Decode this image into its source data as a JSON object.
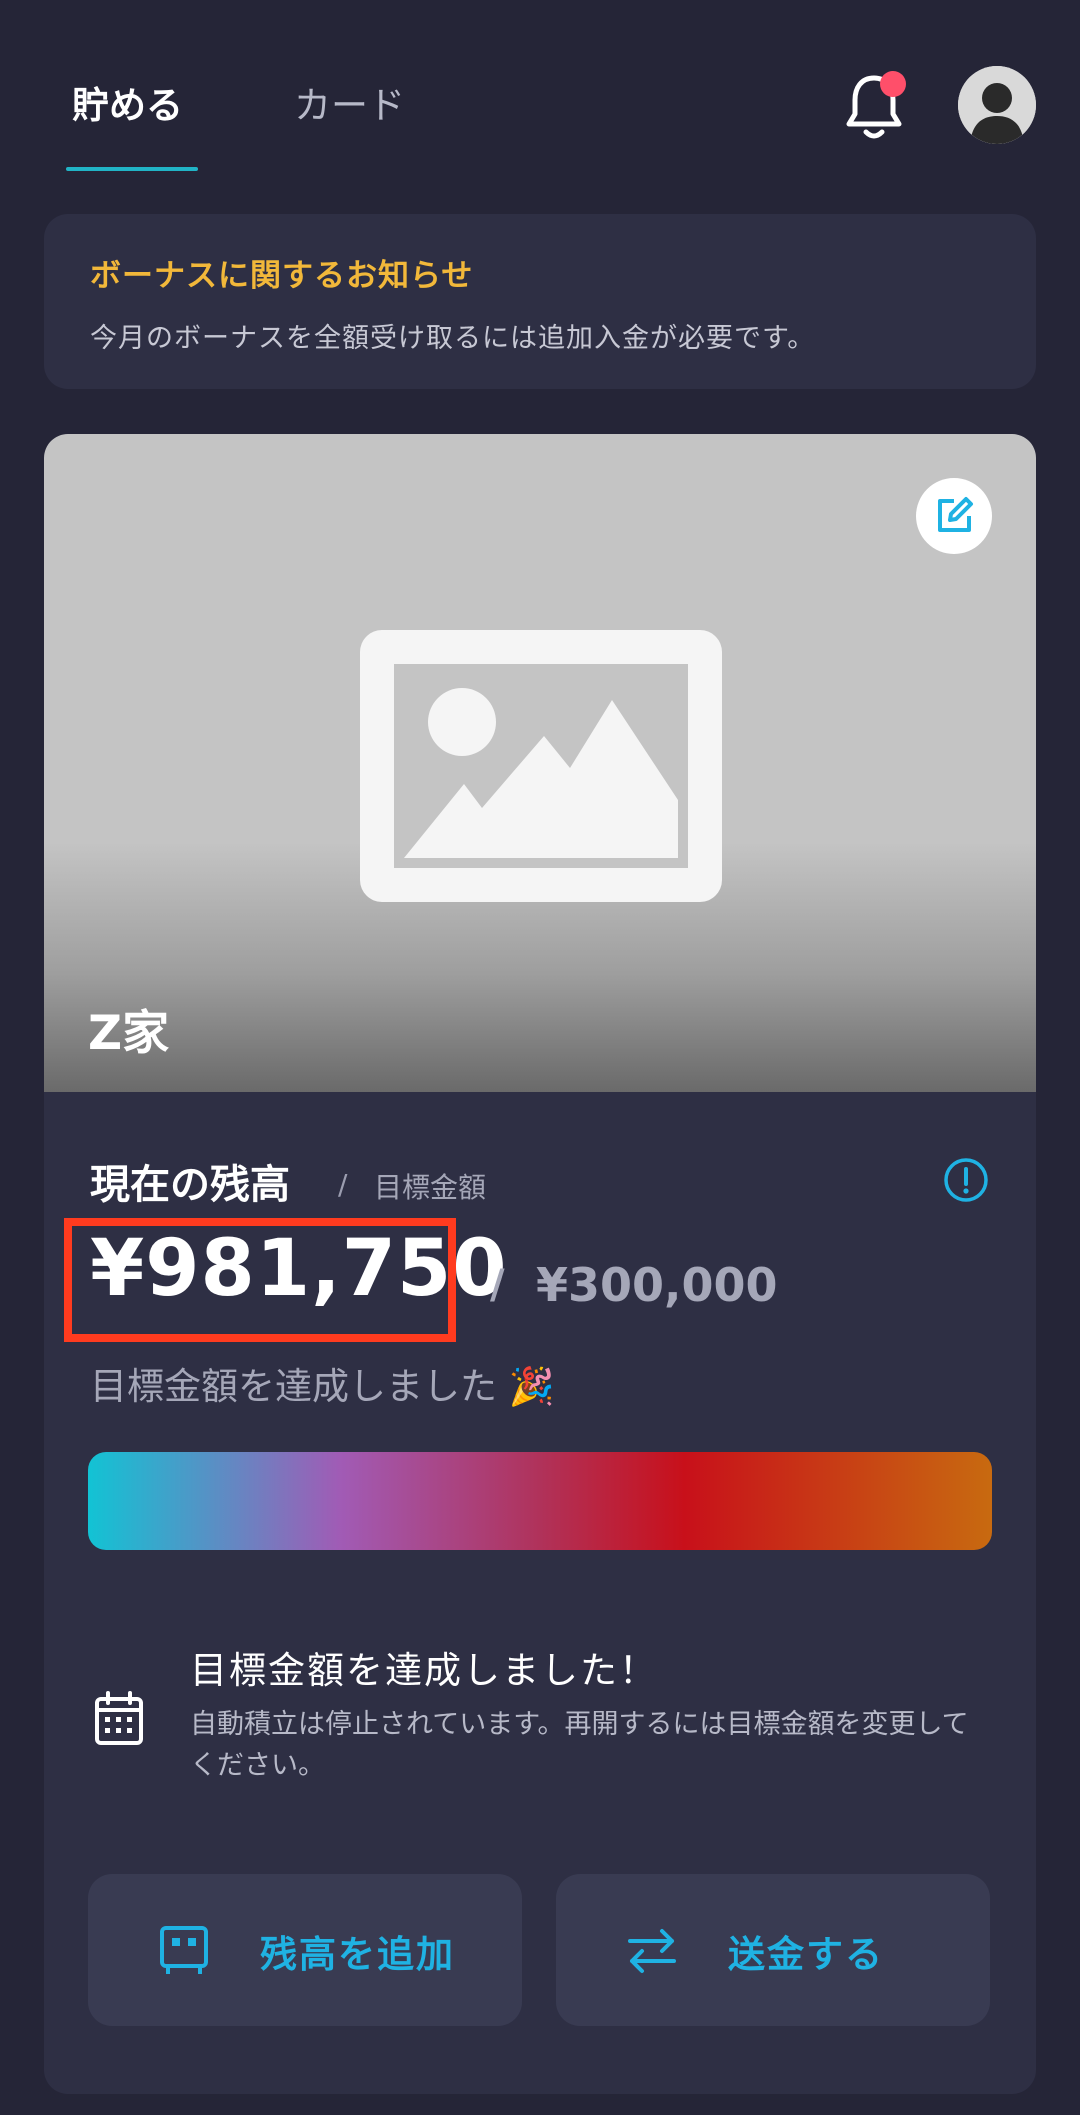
{
  "header": {
    "tabs": [
      {
        "label": "貯める",
        "active": true
      },
      {
        "label": "カード",
        "active": false
      }
    ],
    "icons": {
      "notifications": "bell-icon",
      "profile": "avatar-icon"
    },
    "has_notification_badge": true
  },
  "notice": {
    "title": "ボーナスに関するお知らせ",
    "body": "今月のボーナスを全額受け取るには追加入金が必要です。"
  },
  "goal_card": {
    "name": "Z家",
    "image_placeholder_icon": "image-icon",
    "edit_icon": "edit-icon",
    "balance_label": "現在の残高",
    "separator": "/",
    "target_label": "目標金額",
    "balance": "¥981,750",
    "target_amount": "¥300,000",
    "achieved_text": "目標金額を達成しました 🎉",
    "progress_percent": 100,
    "status_title": "目標金額を達成しました！",
    "status_body": "自動積立は停止されています。再開するには目標金額を変更してください。",
    "info_icon": "info-icon",
    "calendar_icon": "calendar-icon"
  },
  "actions": {
    "add_balance_label": "残高を追加",
    "send_label": "送金する"
  },
  "colors": {
    "background": "#252537",
    "card": "#2e2f44",
    "accent": "#1fb2e3",
    "notice_title": "#f2b83a",
    "highlight_border": "#ff3b1f",
    "badge": "#ff4f6a"
  }
}
